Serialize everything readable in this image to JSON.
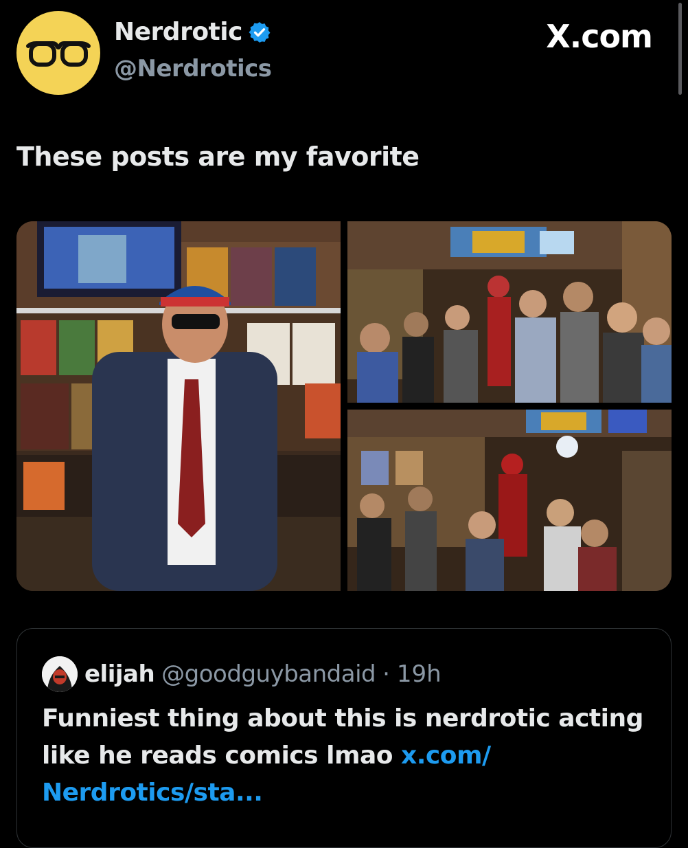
{
  "author": {
    "name": "Nerdrotic",
    "handle": "@Nerdrotics",
    "verified": true,
    "avatar_icon": "glasses-icon",
    "avatar_color": "#f4d356"
  },
  "site_label": "X.com",
  "post": {
    "text": "These posts are my favorite"
  },
  "media": [
    {
      "description_icon": "photo-man-comic-shop"
    },
    {
      "description_icon": "photo-crowd-comic-outpost"
    },
    {
      "description_icon": "photo-crowd-ironman-statue"
    }
  ],
  "quote": {
    "name": "elijah",
    "handle": "@goodguybandaid",
    "separator": "·",
    "time": "19h",
    "text": "Funniest thing about this is nerdrotic acting like he reads comics lmao ",
    "link": "x.com/ Nerdrotics/sta..."
  },
  "colors": {
    "background": "#000000",
    "text": "#e7e9ea",
    "secondary": "#8b98a5",
    "link": "#1d9bf0",
    "verified": "#1d9bf0"
  }
}
